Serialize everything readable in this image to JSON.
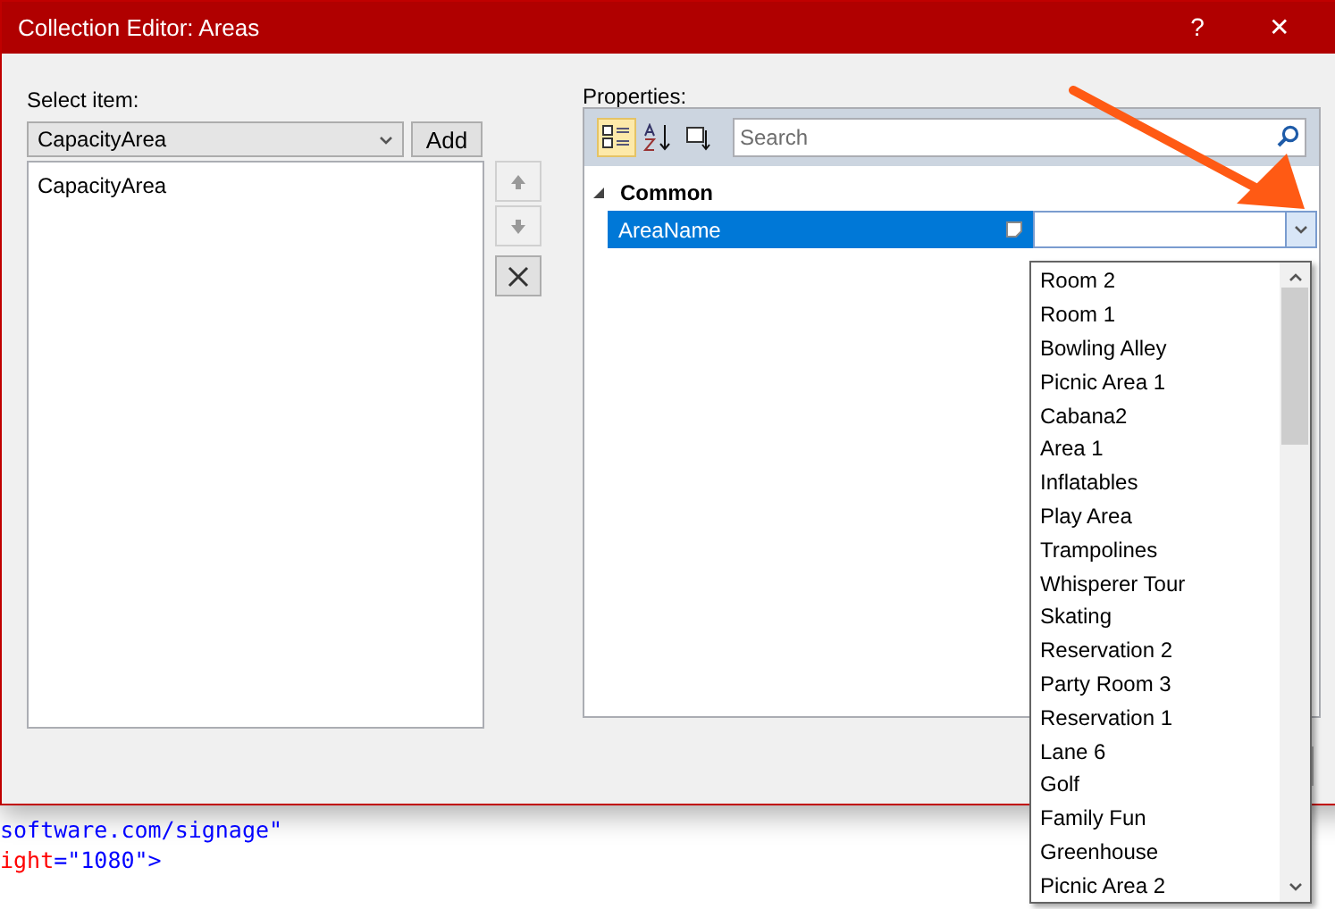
{
  "window": {
    "title": "Collection Editor: Areas",
    "title_buttons": [
      "?",
      "✕"
    ]
  },
  "select_item": {
    "label": "Select item:",
    "combo_value": "CapacityArea",
    "add_button": "Add",
    "items": [
      {
        "label": "CapacityArea",
        "selected": false
      }
    ]
  },
  "properties": {
    "label": "Properties:",
    "search": {
      "placeholder": "Search"
    },
    "categorized_selected": true,
    "categories": [
      {
        "name": "Common",
        "expanded": true,
        "rows": [
          {
            "name": "AreaName",
            "selected": true,
            "value": "",
            "dropdown_open": true
          }
        ]
      }
    ]
  },
  "dropdown": {
    "options": [
      {
        "label": "Room 2"
      },
      {
        "label": "Room 1"
      },
      {
        "label": "Bowling Alley"
      },
      {
        "label": "Picnic Area 1"
      },
      {
        "label": "Cabana2"
      },
      {
        "label": "Area 1"
      },
      {
        "label": "Inflatables"
      },
      {
        "label": "Play Area"
      },
      {
        "label": "Trampolines"
      },
      {
        "label": "Whisperer Tour"
      },
      {
        "label": "Skating"
      },
      {
        "label": "Reservation 2"
      },
      {
        "label": "Party Room 3"
      },
      {
        "label": "Reservation 1"
      },
      {
        "label": "Lane 6"
      },
      {
        "label": "Golf"
      },
      {
        "label": "Family Fun"
      },
      {
        "label": "Greenhouse"
      },
      {
        "label": "Picnic Area 2"
      }
    ]
  },
  "background_code": [
    {
      "segments": [
        {
          "text": "software.com/signage\"",
          "kind": "value"
        }
      ]
    },
    {
      "segments": [
        {
          "text": "ight",
          "kind": "attribute"
        },
        {
          "text": "=\"1080\">",
          "kind": "value"
        }
      ]
    }
  ]
}
